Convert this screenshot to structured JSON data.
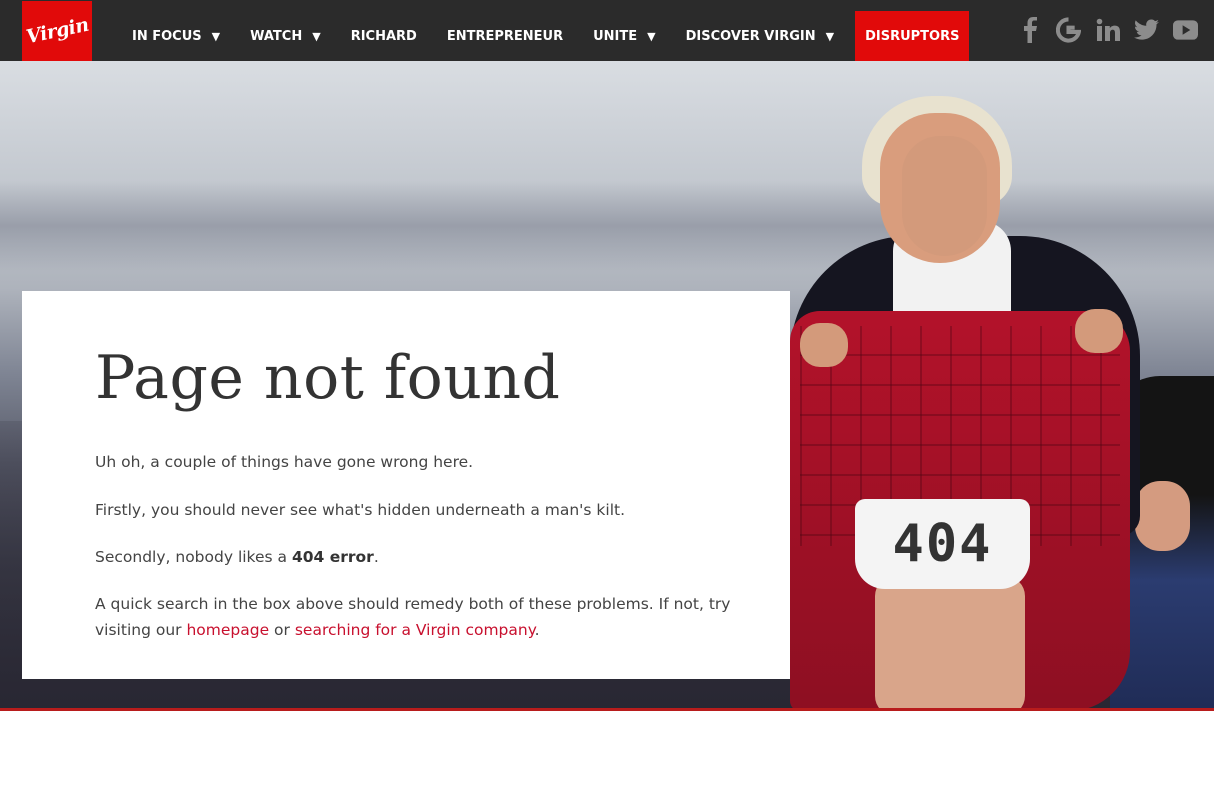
{
  "brand": {
    "logo_text": "Virgin",
    "accent": "#e10a0a"
  },
  "nav": {
    "items": [
      {
        "label": "IN FOCUS",
        "caret": "▼"
      },
      {
        "label": "WATCH",
        "caret": "▼"
      },
      {
        "label": "RICHARD",
        "caret": ""
      },
      {
        "label": "ENTREPRENEUR",
        "caret": ""
      },
      {
        "label": "UNITE",
        "caret": "▼"
      },
      {
        "label": "DISCOVER VIRGIN",
        "caret": "▼"
      }
    ],
    "highlight": "DISRUPTORS"
  },
  "social": [
    {
      "name": "facebook-icon",
      "glyph": "f"
    },
    {
      "name": "google-icon",
      "glyph": "G"
    },
    {
      "name": "linkedin-icon",
      "glyph": "in"
    },
    {
      "name": "twitter-icon",
      "glyph": "t"
    },
    {
      "name": "youtube-icon",
      "glyph": "▶"
    }
  ],
  "hero": {
    "shorts_number": "404"
  },
  "error": {
    "title": "Page not found",
    "line1": "Uh oh, a couple of things have gone wrong here.",
    "line2": "Firstly, you should never see what's hidden underneath a man's kilt.",
    "line3_pre": "Secondly, nobody likes a ",
    "line3_bold": "404 error",
    "line3_post": ".",
    "line4_pre": "A quick search in the box above should remedy both of these problems. If not, try visiting our ",
    "link_home": "homepage",
    "line4_mid": " or ",
    "link_search": "searching for a Virgin company",
    "line4_post": "."
  }
}
